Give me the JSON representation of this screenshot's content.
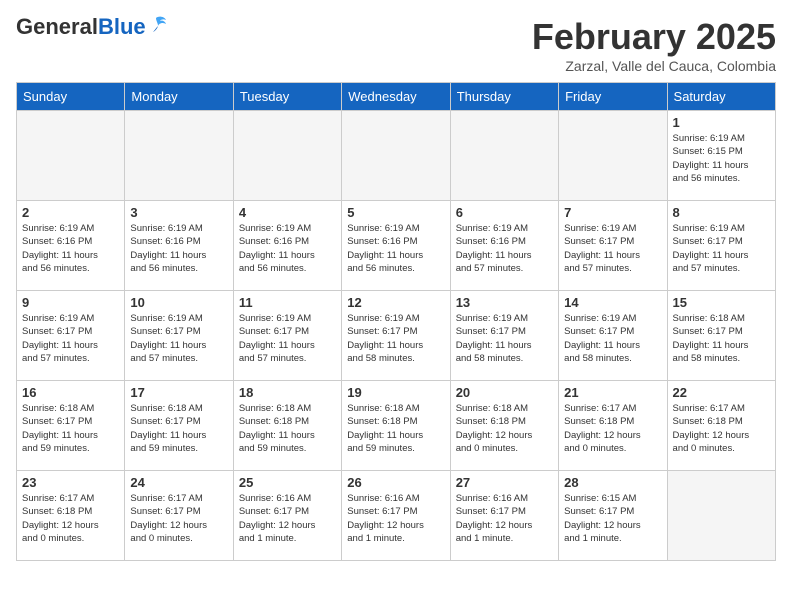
{
  "header": {
    "logo_general": "General",
    "logo_blue": "Blue",
    "month_year": "February 2025",
    "location": "Zarzal, Valle del Cauca, Colombia"
  },
  "days_of_week": [
    "Sunday",
    "Monday",
    "Tuesday",
    "Wednesday",
    "Thursday",
    "Friday",
    "Saturday"
  ],
  "weeks": [
    [
      {
        "day": "",
        "info": ""
      },
      {
        "day": "",
        "info": ""
      },
      {
        "day": "",
        "info": ""
      },
      {
        "day": "",
        "info": ""
      },
      {
        "day": "",
        "info": ""
      },
      {
        "day": "",
        "info": ""
      },
      {
        "day": "1",
        "info": "Sunrise: 6:19 AM\nSunset: 6:15 PM\nDaylight: 11 hours\nand 56 minutes."
      }
    ],
    [
      {
        "day": "2",
        "info": "Sunrise: 6:19 AM\nSunset: 6:16 PM\nDaylight: 11 hours\nand 56 minutes."
      },
      {
        "day": "3",
        "info": "Sunrise: 6:19 AM\nSunset: 6:16 PM\nDaylight: 11 hours\nand 56 minutes."
      },
      {
        "day": "4",
        "info": "Sunrise: 6:19 AM\nSunset: 6:16 PM\nDaylight: 11 hours\nand 56 minutes."
      },
      {
        "day": "5",
        "info": "Sunrise: 6:19 AM\nSunset: 6:16 PM\nDaylight: 11 hours\nand 56 minutes."
      },
      {
        "day": "6",
        "info": "Sunrise: 6:19 AM\nSunset: 6:16 PM\nDaylight: 11 hours\nand 57 minutes."
      },
      {
        "day": "7",
        "info": "Sunrise: 6:19 AM\nSunset: 6:17 PM\nDaylight: 11 hours\nand 57 minutes."
      },
      {
        "day": "8",
        "info": "Sunrise: 6:19 AM\nSunset: 6:17 PM\nDaylight: 11 hours\nand 57 minutes."
      }
    ],
    [
      {
        "day": "9",
        "info": "Sunrise: 6:19 AM\nSunset: 6:17 PM\nDaylight: 11 hours\nand 57 minutes."
      },
      {
        "day": "10",
        "info": "Sunrise: 6:19 AM\nSunset: 6:17 PM\nDaylight: 11 hours\nand 57 minutes."
      },
      {
        "day": "11",
        "info": "Sunrise: 6:19 AM\nSunset: 6:17 PM\nDaylight: 11 hours\nand 57 minutes."
      },
      {
        "day": "12",
        "info": "Sunrise: 6:19 AM\nSunset: 6:17 PM\nDaylight: 11 hours\nand 58 minutes."
      },
      {
        "day": "13",
        "info": "Sunrise: 6:19 AM\nSunset: 6:17 PM\nDaylight: 11 hours\nand 58 minutes."
      },
      {
        "day": "14",
        "info": "Sunrise: 6:19 AM\nSunset: 6:17 PM\nDaylight: 11 hours\nand 58 minutes."
      },
      {
        "day": "15",
        "info": "Sunrise: 6:18 AM\nSunset: 6:17 PM\nDaylight: 11 hours\nand 58 minutes."
      }
    ],
    [
      {
        "day": "16",
        "info": "Sunrise: 6:18 AM\nSunset: 6:17 PM\nDaylight: 11 hours\nand 59 minutes."
      },
      {
        "day": "17",
        "info": "Sunrise: 6:18 AM\nSunset: 6:17 PM\nDaylight: 11 hours\nand 59 minutes."
      },
      {
        "day": "18",
        "info": "Sunrise: 6:18 AM\nSunset: 6:18 PM\nDaylight: 11 hours\nand 59 minutes."
      },
      {
        "day": "19",
        "info": "Sunrise: 6:18 AM\nSunset: 6:18 PM\nDaylight: 11 hours\nand 59 minutes."
      },
      {
        "day": "20",
        "info": "Sunrise: 6:18 AM\nSunset: 6:18 PM\nDaylight: 12 hours\nand 0 minutes."
      },
      {
        "day": "21",
        "info": "Sunrise: 6:17 AM\nSunset: 6:18 PM\nDaylight: 12 hours\nand 0 minutes."
      },
      {
        "day": "22",
        "info": "Sunrise: 6:17 AM\nSunset: 6:18 PM\nDaylight: 12 hours\nand 0 minutes."
      }
    ],
    [
      {
        "day": "23",
        "info": "Sunrise: 6:17 AM\nSunset: 6:18 PM\nDaylight: 12 hours\nand 0 minutes."
      },
      {
        "day": "24",
        "info": "Sunrise: 6:17 AM\nSunset: 6:17 PM\nDaylight: 12 hours\nand 0 minutes."
      },
      {
        "day": "25",
        "info": "Sunrise: 6:16 AM\nSunset: 6:17 PM\nDaylight: 12 hours\nand 1 minute."
      },
      {
        "day": "26",
        "info": "Sunrise: 6:16 AM\nSunset: 6:17 PM\nDaylight: 12 hours\nand 1 minute."
      },
      {
        "day": "27",
        "info": "Sunrise: 6:16 AM\nSunset: 6:17 PM\nDaylight: 12 hours\nand 1 minute."
      },
      {
        "day": "28",
        "info": "Sunrise: 6:15 AM\nSunset: 6:17 PM\nDaylight: 12 hours\nand 1 minute."
      },
      {
        "day": "",
        "info": ""
      }
    ]
  ]
}
